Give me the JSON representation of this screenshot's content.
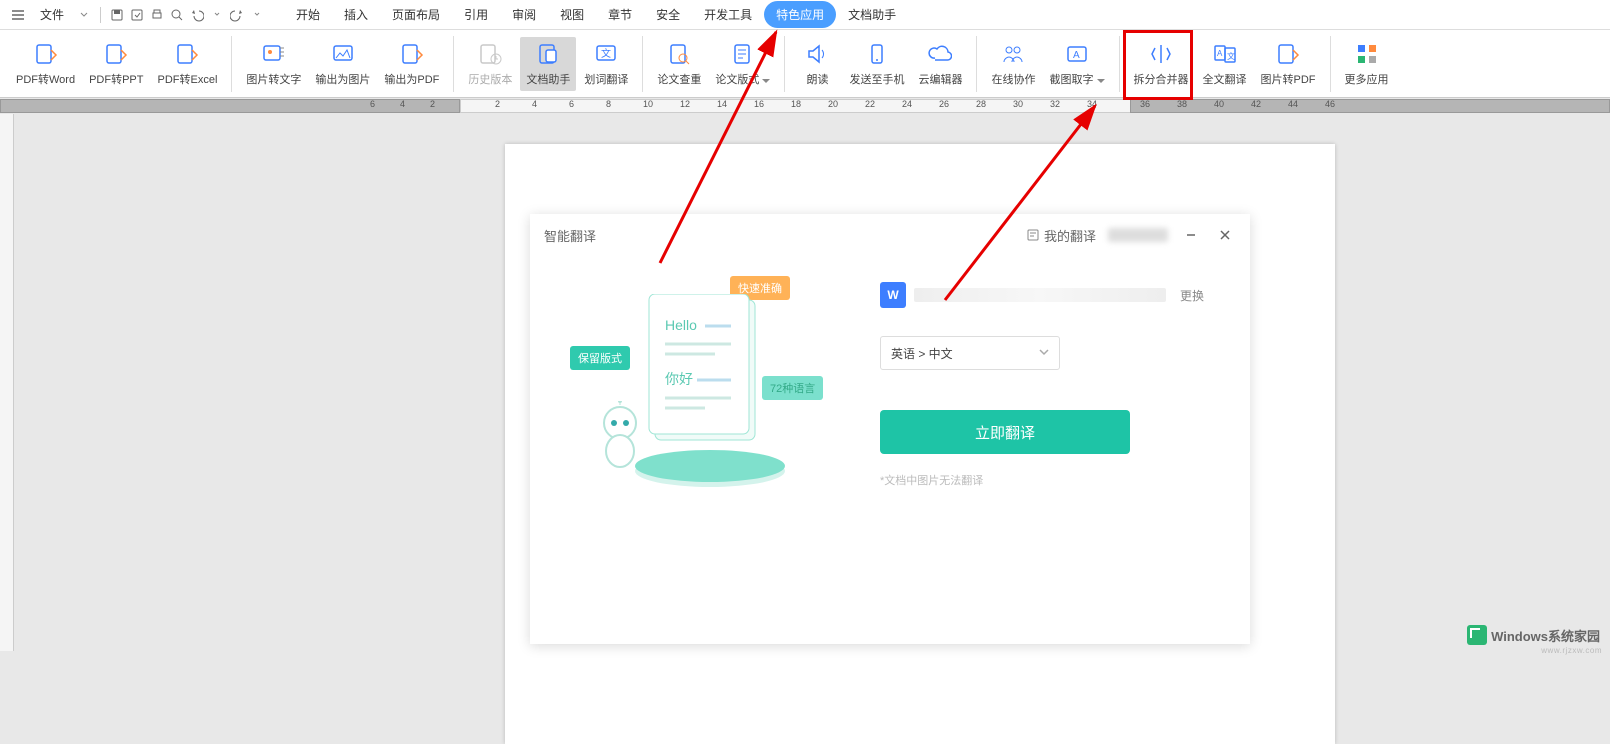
{
  "menubar": {
    "file_label": "文件",
    "tabs": [
      "开始",
      "插入",
      "页面布局",
      "引用",
      "审阅",
      "视图",
      "章节",
      "安全",
      "开发工具",
      "特色应用",
      "文档助手"
    ],
    "active_tab_index": 9
  },
  "ribbon": {
    "groups": [
      [
        {
          "id": "pdf-to-word",
          "label": "PDF转Word"
        },
        {
          "id": "pdf-to-ppt",
          "label": "PDF转PPT"
        },
        {
          "id": "pdf-to-excel",
          "label": "PDF转Excel"
        }
      ],
      [
        {
          "id": "img-to-text",
          "label": "图片转文字"
        },
        {
          "id": "export-img",
          "label": "输出为图片"
        },
        {
          "id": "export-pdf",
          "label": "输出为PDF"
        }
      ],
      [
        {
          "id": "history",
          "label": "历史版本",
          "disabled": true
        },
        {
          "id": "doc-assistant",
          "label": "文档助手",
          "active": true
        },
        {
          "id": "word-translate",
          "label": "划词翻译"
        }
      ],
      [
        {
          "id": "paper-check",
          "label": "论文查重"
        },
        {
          "id": "paper-format",
          "label": "论文版式"
        }
      ],
      [
        {
          "id": "read-aloud",
          "label": "朗读"
        },
        {
          "id": "send-phone",
          "label": "发送至手机"
        },
        {
          "id": "cloud-edit",
          "label": "云编辑器"
        }
      ],
      [
        {
          "id": "online-collab",
          "label": "在线协作"
        },
        {
          "id": "screenshot",
          "label": "截图取字"
        }
      ],
      [
        {
          "id": "split-merge",
          "label": "拆分合并器"
        },
        {
          "id": "full-translate",
          "label": "全文翻译",
          "highlighted": true
        },
        {
          "id": "img-to-pdf",
          "label": "图片转PDF"
        }
      ],
      [
        {
          "id": "more-apps",
          "label": "更多应用"
        }
      ]
    ]
  },
  "ruler": {
    "dark_left": [
      "6",
      "4",
      "2"
    ],
    "light": [
      "2",
      "4",
      "6",
      "8",
      "10",
      "12",
      "14",
      "16",
      "18",
      "20",
      "22",
      "24",
      "26",
      "28",
      "30",
      "32",
      "34"
    ],
    "dark_right": [
      "36",
      "38",
      "40",
      "42",
      "44",
      "46"
    ]
  },
  "dialog": {
    "title": "智能翻译",
    "my_translations": "我的翻译",
    "swap": "更换",
    "lang": "英语 > 中文",
    "translate_btn": "立即翻译",
    "hint": "*文档中图片无法翻译",
    "doc_icon_text": "W",
    "illus": {
      "tag_fast": "快速准确",
      "tag_keep": "保留版式",
      "tag_langs": "72种语言",
      "hello": "Hello",
      "nihao": "你好"
    }
  },
  "watermark": {
    "text": "Windows系统家园",
    "sub": "www.rjzxw.com"
  }
}
